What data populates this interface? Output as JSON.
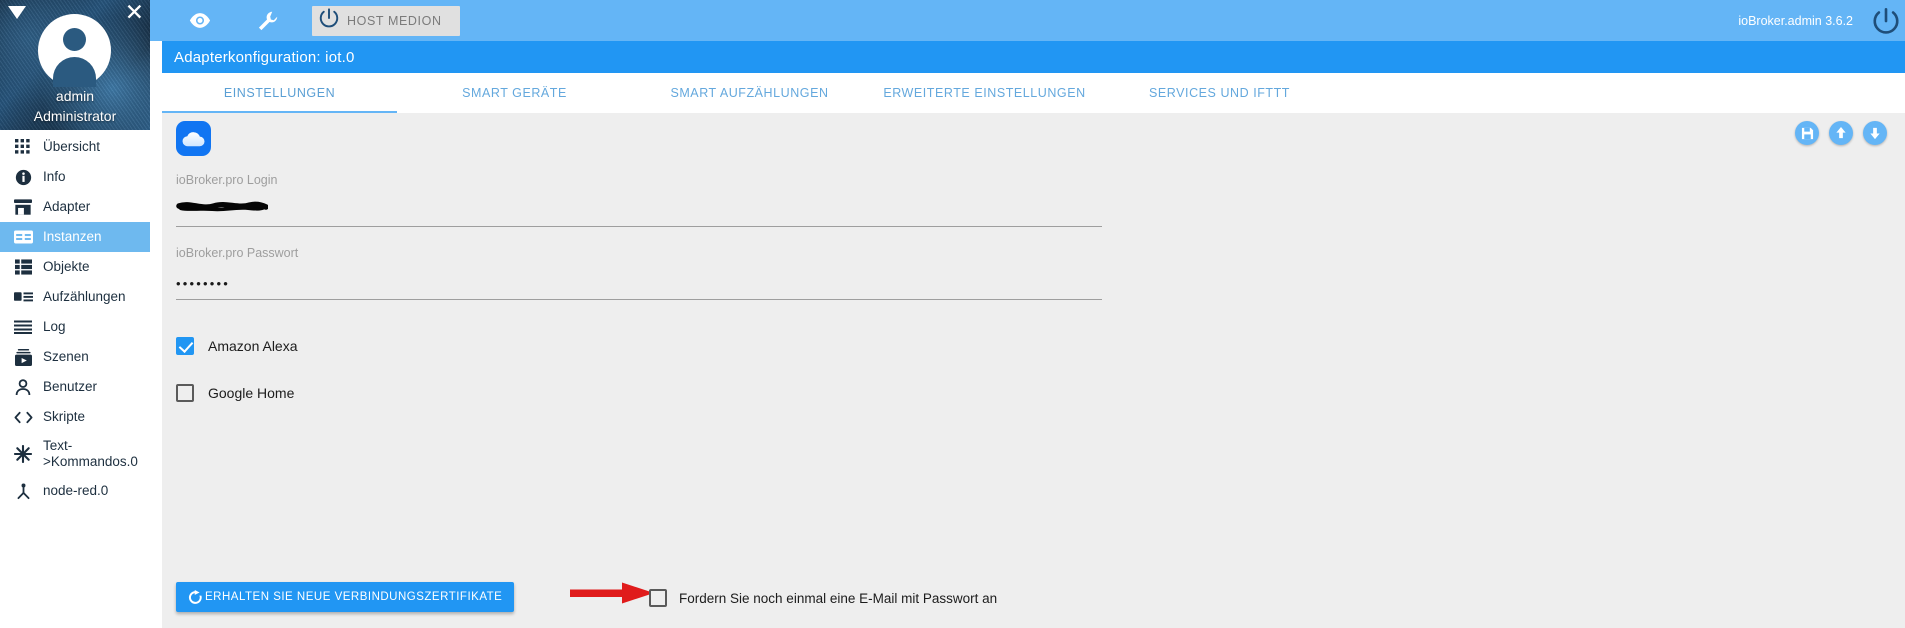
{
  "profile": {
    "name": "admin",
    "role": "Administrator",
    "caret_icon": "caret-down-icon",
    "close_icon": "close-icon",
    "avatar_icon": "user-avatar-icon"
  },
  "sidebar": {
    "items": [
      {
        "label": "Übersicht",
        "icon": "grid-icon",
        "active": false
      },
      {
        "label": "Info",
        "icon": "info-icon",
        "active": false
      },
      {
        "label": "Adapter",
        "icon": "store-icon",
        "active": false
      },
      {
        "label": "Instanzen",
        "icon": "instances-icon",
        "active": true
      },
      {
        "label": "Objekte",
        "icon": "list-icon",
        "active": false
      },
      {
        "label": "Aufzählungen",
        "icon": "enum-icon",
        "active": false
      },
      {
        "label": "Log",
        "icon": "log-lines-icon",
        "active": false
      },
      {
        "label": "Szenen",
        "icon": "scenes-play-icon",
        "active": false
      },
      {
        "label": "Benutzer",
        "icon": "person-icon",
        "active": false
      },
      {
        "label": "Skripte",
        "icon": "code-brackets-icon",
        "active": false
      },
      {
        "label": "Text->Kommandos.0",
        "icon": "asterisk-icon",
        "active": false
      },
      {
        "label": "node-red.0",
        "icon": "node-red-icon",
        "active": false
      }
    ]
  },
  "topbar": {
    "eye_icon": "eye-icon",
    "wrench_icon": "wrench-icon",
    "host_chip_icon": "power-info-icon",
    "host_chip_label": "HOST MEDION",
    "version": "ioBroker.admin 3.6.2",
    "logo_icon": "iobroker-logo-icon",
    "background_color": "#64b5f6"
  },
  "config": {
    "title": "Adapterkonfiguration: iot.0",
    "title_background": "#2196f3",
    "tabs": [
      {
        "label": "EINSTELLUNGEN",
        "active": true
      },
      {
        "label": "SMART GERÄTE",
        "active": false
      },
      {
        "label": "SMART AUFZÄHLUNGEN",
        "active": false
      },
      {
        "label": "ERWEITERTE EINSTELLUNGEN",
        "active": false
      },
      {
        "label": "SERVICES UND IFTTT",
        "active": false
      }
    ],
    "adapter_icon": "cloud-icon",
    "panel_actions": [
      {
        "icon": "save-disk-icon",
        "color": "#64b5f6"
      },
      {
        "icon": "upload-arrow-icon",
        "color": "#64b5f6"
      },
      {
        "icon": "download-arrow-icon",
        "color": "#64b5f6"
      }
    ],
    "fields": {
      "login_label": "ioBroker.pro Login",
      "login_value": "",
      "login_redacted": true,
      "password_label": "ioBroker.pro Passwort",
      "password_value": "••••••••"
    },
    "checkboxes": [
      {
        "label": "Amazon Alexa",
        "checked": true
      },
      {
        "label": "Google Home",
        "checked": false
      }
    ],
    "cert_button": {
      "label": "ERHALTEN SIE NEUE VERBINDUNGSZERTIFIKATE",
      "icon": "refresh-icon",
      "color": "#2196f3"
    },
    "annotation_arrow": {
      "icon": "red-arrow-right-icon",
      "color": "#e01b1b"
    },
    "email_checkbox": {
      "label": "Fordern Sie noch einmal eine E-Mail mit Passwort an",
      "checked": false
    }
  }
}
